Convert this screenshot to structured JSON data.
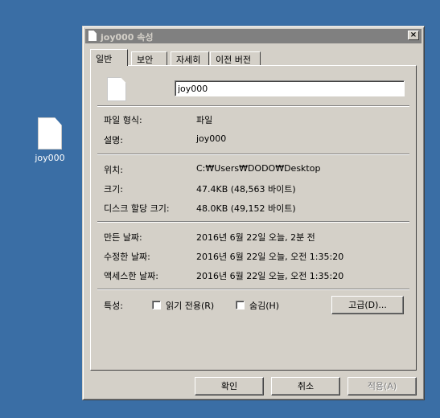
{
  "desktop": {
    "file_label": "joy000"
  },
  "window": {
    "title": "joy000 속성",
    "close_glyph": "×",
    "tabs": [
      {
        "label": "일반"
      },
      {
        "label": "보안"
      },
      {
        "label": "자세히"
      },
      {
        "label": "이전 버전"
      }
    ],
    "name_value": "joy000",
    "rows": {
      "file_type": {
        "label": "파일 형식:",
        "value": "파일"
      },
      "description": {
        "label": "설명:",
        "value": "joy000"
      },
      "location": {
        "label": "위치:",
        "value": "C:₩Users₩DODO₩Desktop"
      },
      "size": {
        "label": "크기:",
        "value": "47.4KB (48,563 바이트)"
      },
      "size_on_disk": {
        "label": "디스크 할당 크기:",
        "value": "48.0KB (49,152 바이트)"
      },
      "created": {
        "label": "만든 날짜:",
        "value": "2016년 6월 22일 오늘, 2분 전"
      },
      "modified": {
        "label": "수정한 날짜:",
        "value": "2016년 6월 22일 오늘, 오전 1:35:20"
      },
      "accessed": {
        "label": "액세스한 날짜:",
        "value": "2016년 6월 22일 오늘, 오전 1:35:20"
      }
    },
    "attributes": {
      "label": "특성:",
      "readonly_label": "읽기 전용(R)",
      "readonly_checked": false,
      "hidden_label": "숨김(H)",
      "hidden_checked": false,
      "advanced_label": "고급(D)..."
    },
    "buttons": {
      "ok": "확인",
      "cancel": "취소",
      "apply": "적용(A)"
    }
  }
}
